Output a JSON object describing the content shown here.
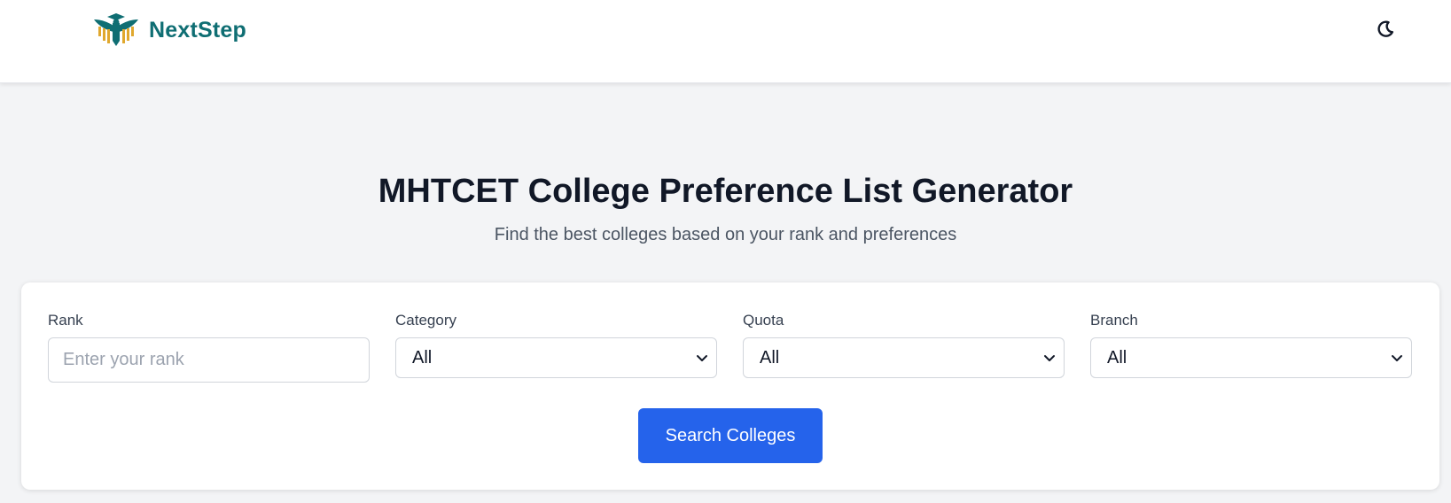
{
  "navbar": {
    "brand_name": "NextStep",
    "logo_icon": "graduation-eagle-logo",
    "theme_toggle_icon": "moon-icon"
  },
  "hero": {
    "title": "MHTCET College Preference List Generator",
    "subtitle": "Find the best colleges based on your rank and preferences"
  },
  "form": {
    "rank": {
      "label": "Rank",
      "placeholder": "Enter your rank",
      "value": ""
    },
    "category": {
      "label": "Category",
      "selected": "All"
    },
    "quota": {
      "label": "Quota",
      "selected": "All"
    },
    "branch": {
      "label": "Branch",
      "selected": "All"
    },
    "search_button": "Search Colleges"
  },
  "colors": {
    "brand": "#0f6e73",
    "accent": "#2563eb",
    "page_bg": "#f3f4f6",
    "logo_gold": "#e0a82e"
  }
}
